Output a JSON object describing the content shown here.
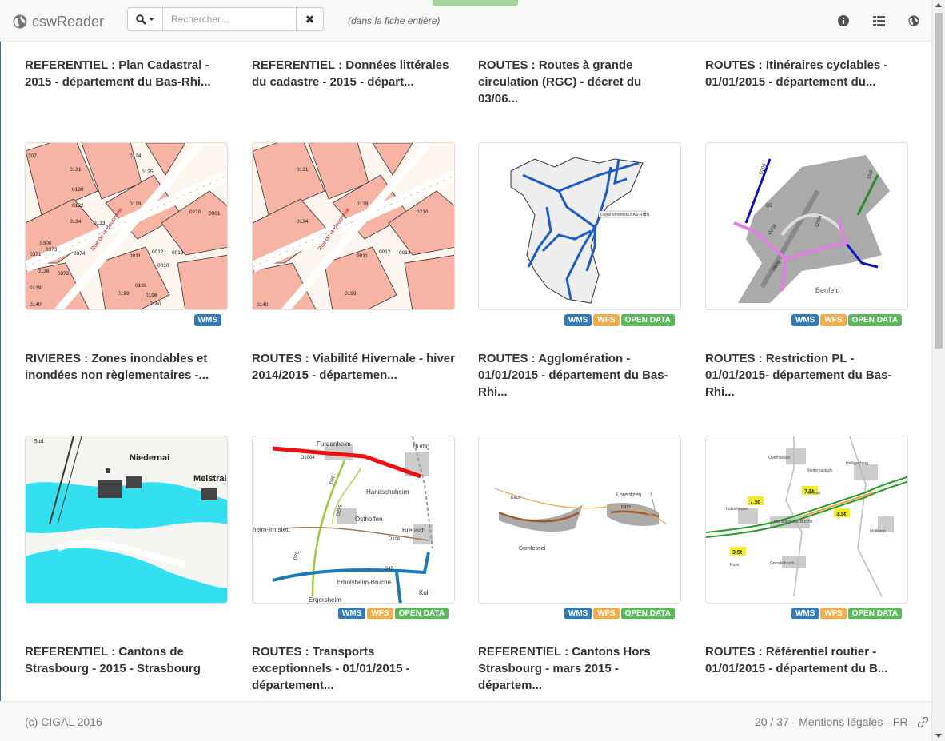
{
  "app": {
    "title": "cswReader"
  },
  "search": {
    "placeholder": "Rechercher...",
    "scope_hint": "(dans la fiche entière)",
    "clear_label": "✖"
  },
  "badges": {
    "wms": "WMS",
    "wfs": "WFS",
    "open_data": "OPEN DATA"
  },
  "records": [
    {
      "title": "REFERENTIEL : Plan Cadastral - 2015 - département du Bas-Rhi...",
      "thumb": "cadastre",
      "wms": true,
      "wfs": false,
      "open_data": false
    },
    {
      "title": "REFERENTIEL : Données littérales du cadastre - 2015 - départ...",
      "thumb": "cadastre",
      "wms": false,
      "wfs": false,
      "open_data": false
    },
    {
      "title": "ROUTES : Routes à grande circulation (RGC) - décret du 03/06...",
      "thumb": "dept",
      "wms": true,
      "wfs": true,
      "open_data": true
    },
    {
      "title": "ROUTES : Itinéraires cyclables - 01/01/2015 - département du...",
      "thumb": "cycle",
      "wms": true,
      "wfs": true,
      "open_data": true
    },
    {
      "title": "RIVIERES : Zones inondables et inondées non règlementaires -...",
      "thumb": "flood",
      "wms": false,
      "wfs": false,
      "open_data": false
    },
    {
      "title": "ROUTES : Viabilité Hivernale - hiver 2014/2015 - départemen...",
      "thumb": "winter",
      "wms": true,
      "wfs": true,
      "open_data": true
    },
    {
      "title": "ROUTES : Agglomération - 01/01/2015 - département du Bas-Rhi...",
      "thumb": "agglo",
      "wms": true,
      "wfs": true,
      "open_data": true
    },
    {
      "title": "ROUTES : Restriction PL - 01/01/2015- département du Bas-Rhi...",
      "thumb": "restr",
      "wms": true,
      "wfs": true,
      "open_data": true
    },
    {
      "title": "REFERENTIEL : Cantons de Strasbourg - 2015 - Strasbourg",
      "thumb": "",
      "wms": false,
      "wfs": false,
      "open_data": false
    },
    {
      "title": "ROUTES : Transports exceptionnels - 01/01/2015 - département...",
      "thumb": "",
      "wms": false,
      "wfs": false,
      "open_data": false
    },
    {
      "title": "REFERENTIEL : Cantons Hors Strasbourg - mars 2015 - départem...",
      "thumb": "",
      "wms": false,
      "wfs": false,
      "open_data": false
    },
    {
      "title": "ROUTES : Référentiel routier - 01/01/2015 - département du B...",
      "thumb": "",
      "wms": false,
      "wfs": false,
      "open_data": false
    }
  ],
  "map_labels": {
    "cadastre_street": "Rue de la Boucherie",
    "cadastre_parcels": [
      "0131",
      "0130",
      "0129",
      "0210",
      "0001",
      "0132",
      "0134",
      "0133",
      "0300",
      "0373",
      "0374",
      "0371",
      "0011",
      "0012",
      "0013",
      "0010",
      "0138",
      "0372",
      "0139",
      "0196",
      "0199",
      "0198",
      "0140",
      "0160",
      "307",
      "0124",
      "0125"
    ],
    "dept_label": "Département du BAS-RHIN",
    "cycle_labels": [
      "D206",
      "D5",
      "D29",
      "D208",
      "D204",
      "D829"
    ],
    "cycle_place": "Benfeld",
    "flood_places": [
      "Niedernai",
      "Meistral",
      "Sud"
    ],
    "winter_places": [
      "Furdenheim",
      "Hurtig",
      "Handschuheim",
      "Osthoffen",
      "Breusch",
      "heim-Irmstett",
      "Ernolsheim-Bruche",
      "Ergersheim",
      "Koll"
    ],
    "winter_roads": [
      "D1004",
      "D30",
      "D225",
      "D118",
      "D45",
      "D75",
      "D63",
      "D174"
    ],
    "agglo_places": [
      "Lorentzen",
      "Domfessel"
    ],
    "agglo_roads": [
      "D919",
      "D915"
    ],
    "restr_places": [
      "Oberhausen",
      "Niederhaslach",
      "Urmatt",
      "Lutzelhouse",
      "Muhlbach-Sur-Bruche",
      "Heiligenberg",
      "Mollkirch",
      "Russ",
      "Grendelbruch"
    ],
    "restr_tonnage": [
      "7.5t",
      "7.5t",
      "3.5t",
      "3.5t"
    ]
  },
  "footer": {
    "copyright": "(c) CIGAL 2016",
    "pagination": "20 / 37 - Mentions légales - FR -"
  }
}
